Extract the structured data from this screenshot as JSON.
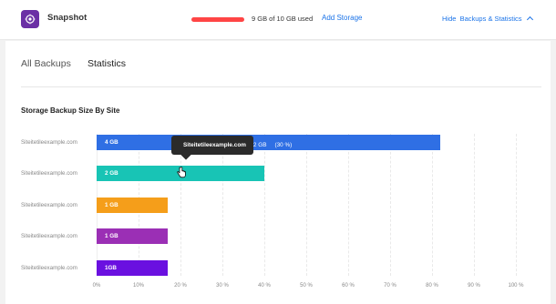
{
  "header": {
    "app_title": "Snapshot",
    "usage_text": "9 GB of 10 GB used",
    "usage_fraction": 0.9,
    "usage_color": "#ff4545",
    "add_storage": "Add Storage",
    "hide_link": "Hide  Backups & Statistics",
    "logo_icon": "snapshot-logo-icon",
    "logo_color": "#6b2fa5",
    "chevron_icon": "chevron-up-icon"
  },
  "tabs": [
    {
      "label": "All Backups",
      "active": false
    },
    {
      "label": "Statistics",
      "active": true
    }
  ],
  "section": {
    "title": "Storage Backup Size By Site"
  },
  "tooltip": {
    "site": "Siteitetileexample.com",
    "size": "2 GB",
    "percent": "(30 %)",
    "dot_color": "#18c4b5"
  },
  "chart_data": {
    "type": "bar",
    "orientation": "horizontal",
    "title": "Storage Backup Size By Site",
    "categories": [
      "Siteitetileexample.com",
      "Siteitetileexample.com",
      "Siteitetileexample.com",
      "Siteitetileexample.com",
      "Siteitetileexample.com"
    ],
    "values": [
      82,
      40,
      17,
      17,
      17
    ],
    "bar_labels": [
      "4 GB",
      "2 GB",
      "1 GB",
      "1 GB",
      "1GB"
    ],
    "colors": [
      "#2f6fe4",
      "#18c4b5",
      "#f59e1a",
      "#9b2fb5",
      "#6a10e0"
    ],
    "x_ticks": [
      "0%",
      "10%",
      "20 %",
      "30 %",
      "40 %",
      "50 %",
      "60 %",
      "70 %",
      "80 %",
      "90 %",
      "100 %"
    ],
    "xlim": [
      0,
      100
    ],
    "xlabel": "",
    "ylabel": "",
    "grid": true,
    "legend": "none"
  }
}
